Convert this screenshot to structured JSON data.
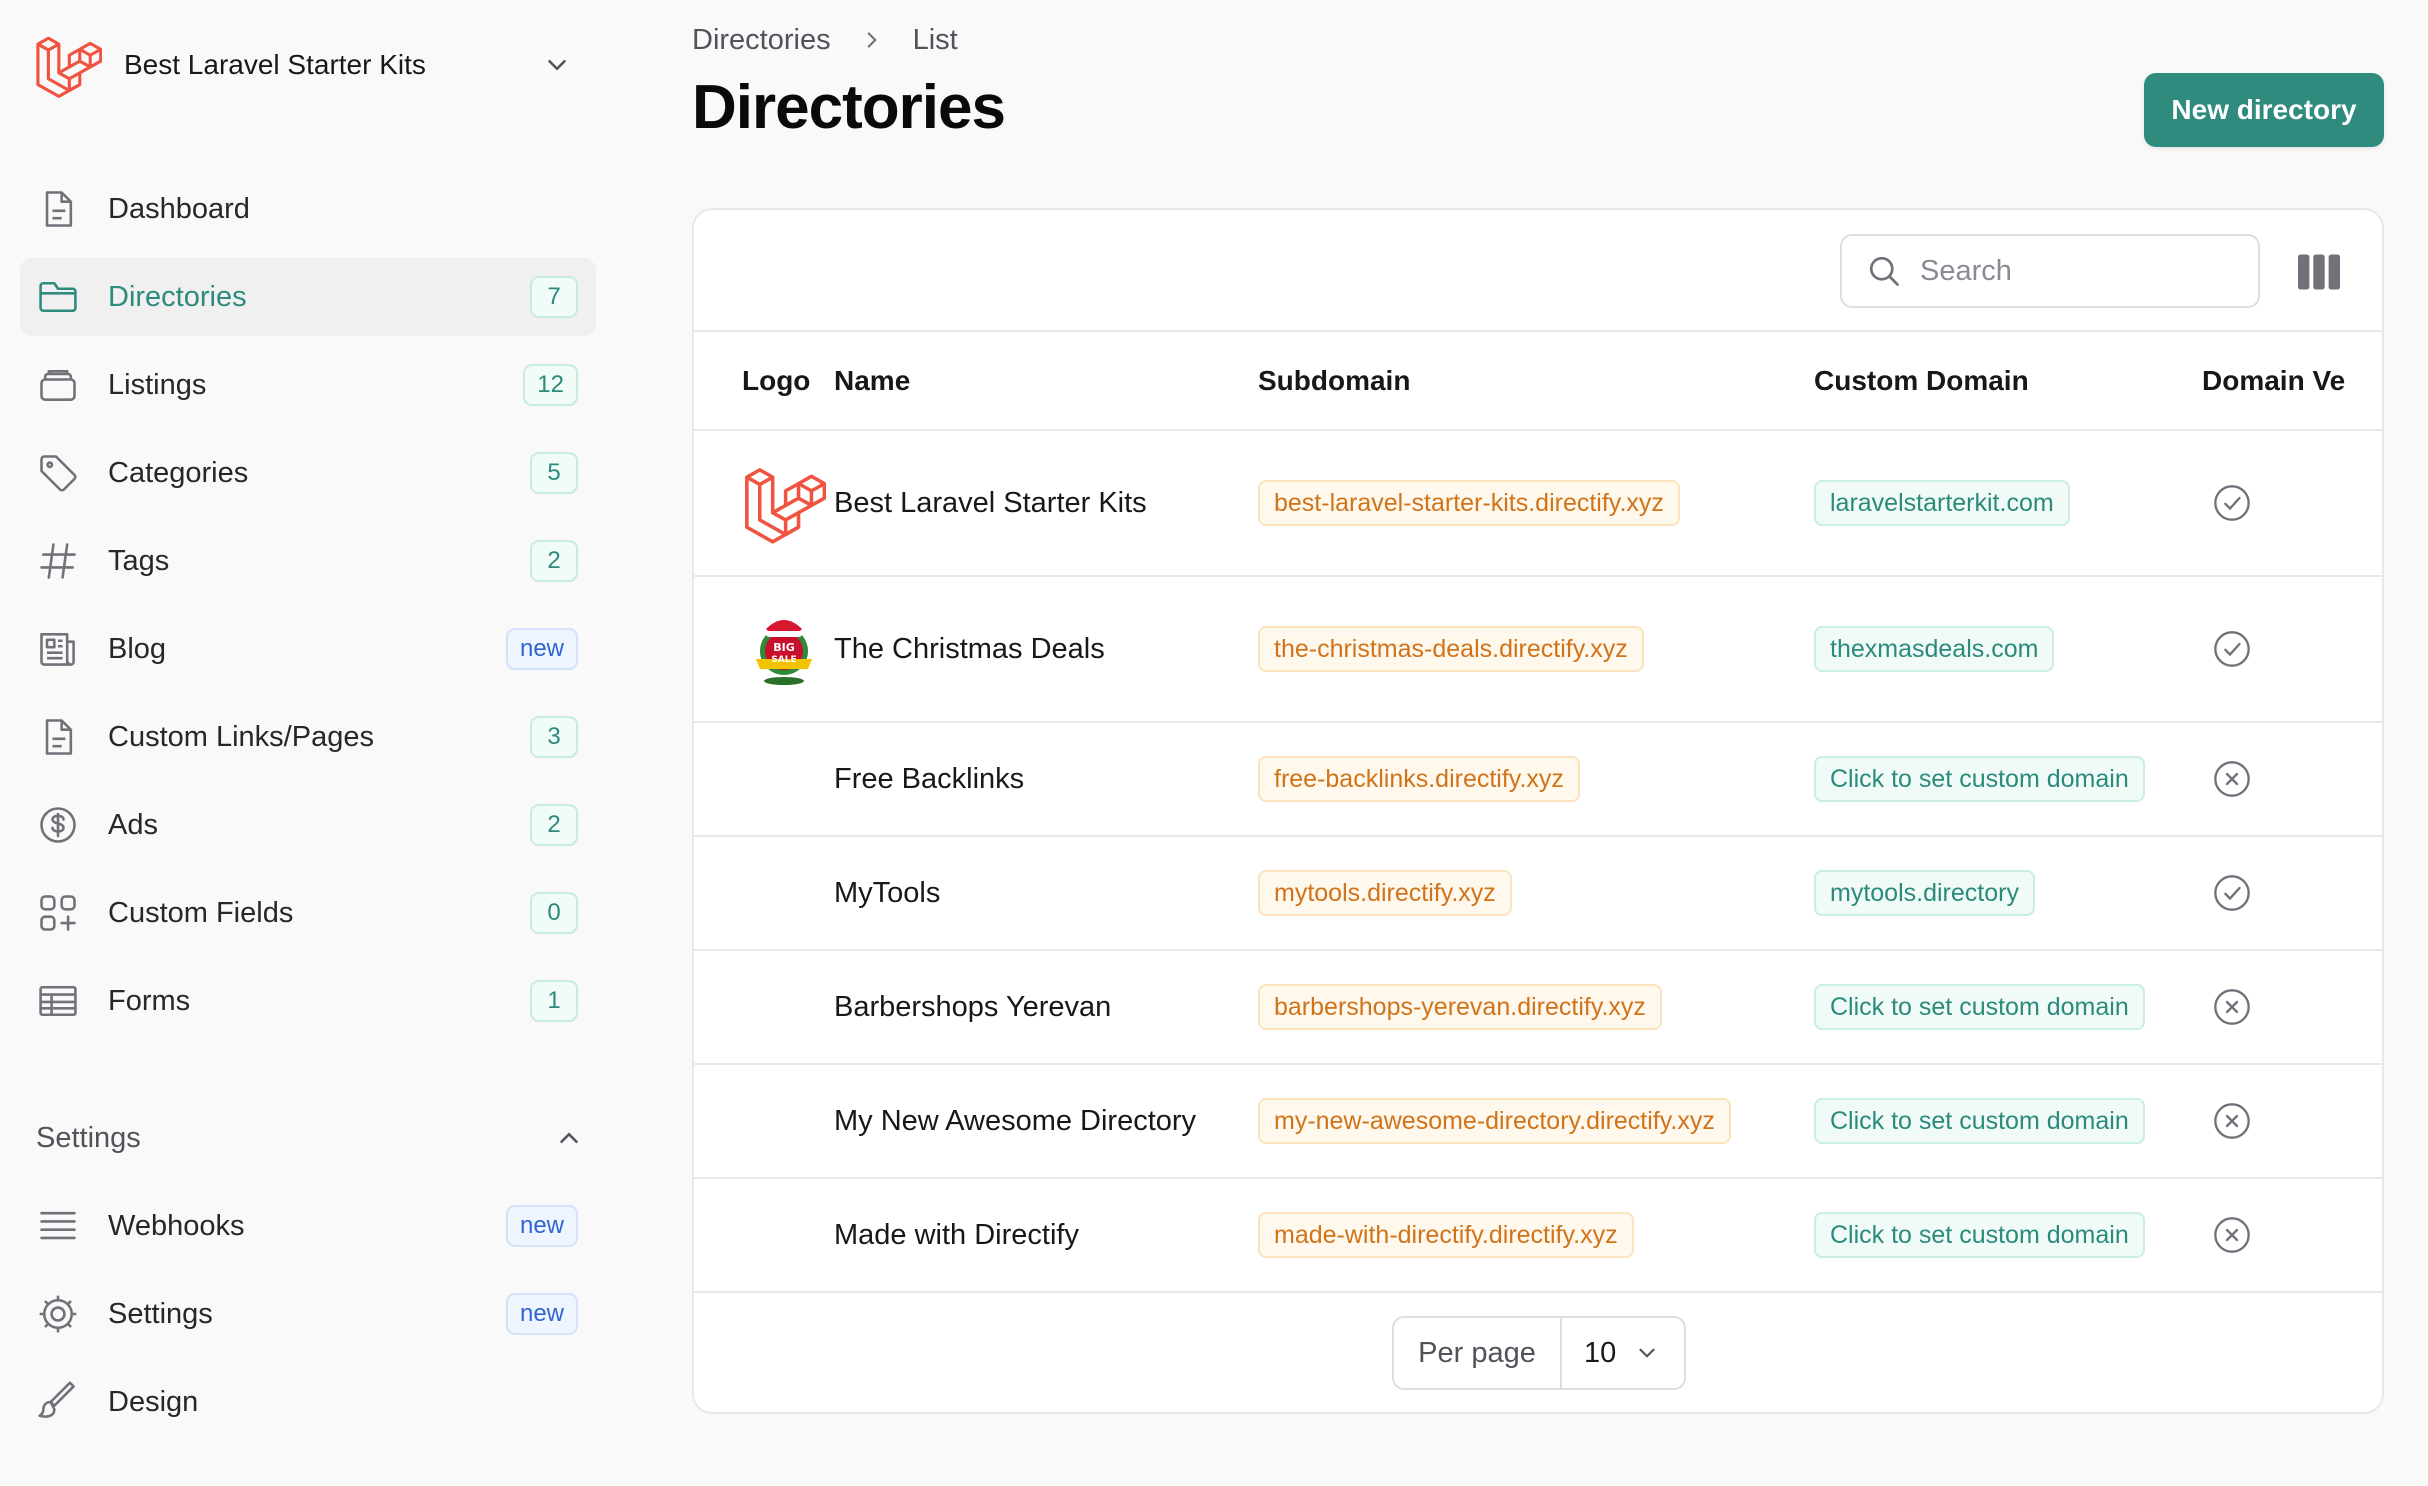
{
  "brand": {
    "name": "Best Laravel Starter Kits",
    "icon": "laravel-logo-icon",
    "accent": "#f05340"
  },
  "nav": [
    {
      "id": "dashboard",
      "label": "Dashboard",
      "icon": "document-icon",
      "badge": ""
    },
    {
      "id": "directories",
      "label": "Directories",
      "icon": "folder-icon",
      "badge": "7",
      "active": true
    },
    {
      "id": "listings",
      "label": "Listings",
      "icon": "stack-icon",
      "badge": "12"
    },
    {
      "id": "categories",
      "label": "Categories",
      "icon": "tag-icon",
      "badge": "5"
    },
    {
      "id": "tags",
      "label": "Tags",
      "icon": "hashtag-icon",
      "badge": "2"
    },
    {
      "id": "blog",
      "label": "Blog",
      "icon": "newspaper-icon",
      "badge": "new"
    },
    {
      "id": "custom-links",
      "label": "Custom Links/Pages",
      "icon": "document-icon",
      "badge": "3"
    },
    {
      "id": "ads",
      "label": "Ads",
      "icon": "dollar-icon",
      "badge": "2"
    },
    {
      "id": "custom-fields",
      "label": "Custom Fields",
      "icon": "squares-plus-icon",
      "badge": "0"
    },
    {
      "id": "forms",
      "label": "Forms",
      "icon": "table-icon",
      "badge": "1"
    }
  ],
  "settings": {
    "title": "Settings",
    "items": [
      {
        "id": "webhooks",
        "label": "Webhooks",
        "icon": "bars-icon",
        "badge": "new"
      },
      {
        "id": "settings",
        "label": "Settings",
        "icon": "cog-icon",
        "badge": "new"
      },
      {
        "id": "design",
        "label": "Design",
        "icon": "paintbrush-icon",
        "badge": ""
      }
    ]
  },
  "breadcrumb": [
    "Directories",
    "List"
  ],
  "page": {
    "title": "Directories",
    "new_button": "New directory"
  },
  "search": {
    "placeholder": "Search",
    "value": ""
  },
  "table": {
    "columns": [
      "Logo",
      "Name",
      "Subdomain",
      "Custom Domain",
      "Domain Ve"
    ],
    "rows": [
      {
        "logo": "laravel-logo-icon",
        "name": "Best Laravel Starter Kits",
        "subdomain": "best-laravel-starter-kits.directify.xyz",
        "domain": "laravelstarterkit.com",
        "verified": true
      },
      {
        "logo": "big-sale-christmas-logo",
        "name": "The Christmas Deals",
        "subdomain": "the-christmas-deals.directify.xyz",
        "domain": "thexmasdeals.com",
        "verified": true
      },
      {
        "logo": "",
        "name": "Free Backlinks",
        "subdomain": "free-backlinks.directify.xyz",
        "domain": "Click to set custom domain",
        "verified": false
      },
      {
        "logo": "",
        "name": "MyTools",
        "subdomain": "mytools.directify.xyz",
        "domain": "mytools.directory",
        "verified": true
      },
      {
        "logo": "",
        "name": "Barbershops Yerevan",
        "subdomain": "barbershops-yerevan.directify.xyz",
        "domain": "Click to set custom domain",
        "verified": false
      },
      {
        "logo": "",
        "name": "My New Awesome Directory",
        "subdomain": "my-new-awesome-directory.directify.xyz",
        "domain": "Click to set custom domain",
        "verified": false
      },
      {
        "logo": "",
        "name": "Made with Directify",
        "subdomain": "made-with-directify.directify.xyz",
        "domain": "Click to set custom domain",
        "verified": false
      }
    ]
  },
  "pagination": {
    "label": "Per page",
    "value": "10"
  },
  "colors": {
    "primary": "#2e8b7d",
    "subdomain": "#d0731a",
    "badge_new": "#2f65cf"
  }
}
